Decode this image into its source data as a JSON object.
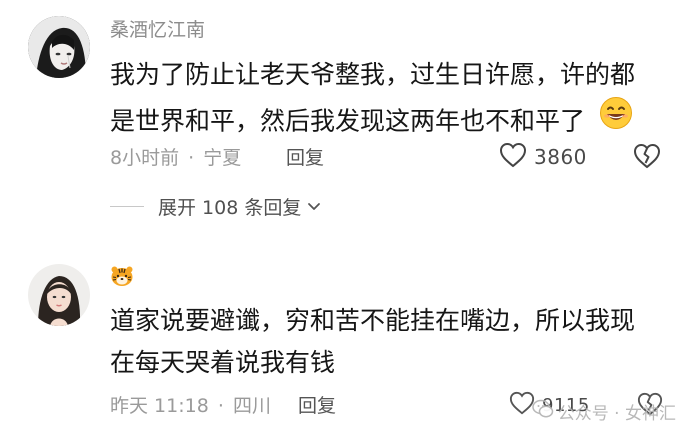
{
  "comments": [
    {
      "username": "桑酒忆江南",
      "text_line1": "我为了防止让老天爷整我，过生日许愿，许的都",
      "text_line2": "是世界和平，然后我发现这两年也不和平了",
      "time": "8小时前",
      "location": "宁夏",
      "meta_sep": "·",
      "reply_label": "回复",
      "likes": "3860",
      "expand_label": "展开 108 条回复"
    },
    {
      "username_icon": "tiger-emoji-icon",
      "text_line1": "道家说要避谶，穷和苦不能挂在嘴边，所以我现",
      "text_line2": "在每天哭着说我有钱",
      "time": "昨天 11:18",
      "location": "四川",
      "meta_sep": "·",
      "reply_label": "回复",
      "likes": "9115"
    }
  ],
  "watermark": {
    "text": "公众号 · 女神汇",
    "icon": "wechat-icon"
  },
  "colors": {
    "username": "#8c8c8c",
    "meta": "#9a9a9a",
    "text": "#161616"
  }
}
